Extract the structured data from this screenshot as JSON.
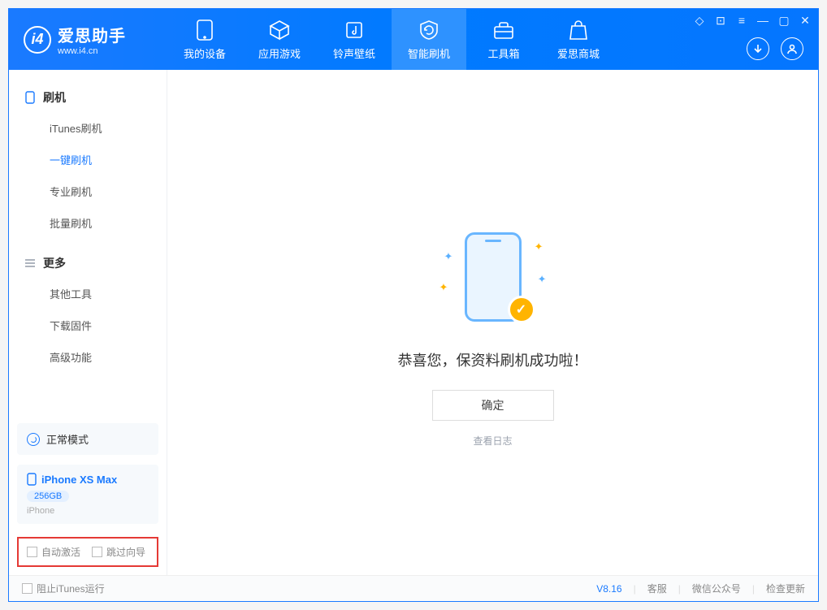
{
  "app": {
    "title": "爱思助手",
    "site": "www.i4.cn"
  },
  "nav": {
    "tabs": [
      {
        "label": "我的设备"
      },
      {
        "label": "应用游戏"
      },
      {
        "label": "铃声壁纸"
      },
      {
        "label": "智能刷机"
      },
      {
        "label": "工具箱"
      },
      {
        "label": "爱思商城"
      }
    ]
  },
  "sidebar": {
    "groups": [
      {
        "title": "刷机",
        "items": [
          "iTunes刷机",
          "一键刷机",
          "专业刷机",
          "批量刷机"
        ]
      },
      {
        "title": "更多",
        "items": [
          "其他工具",
          "下载固件",
          "高级功能"
        ]
      }
    ],
    "mode_label": "正常模式",
    "device": {
      "name": "iPhone XS Max",
      "capacity": "256GB",
      "type": "iPhone"
    },
    "opts": {
      "auto_activate": "自动激活",
      "skip_guide": "跳过向导"
    }
  },
  "main": {
    "success_msg": "恭喜您，保资料刷机成功啦！",
    "ok_btn": "确定",
    "view_log": "查看日志"
  },
  "footer": {
    "block_itunes": "阻止iTunes运行",
    "version": "V8.16",
    "links": [
      "客服",
      "微信公众号",
      "检查更新"
    ]
  }
}
